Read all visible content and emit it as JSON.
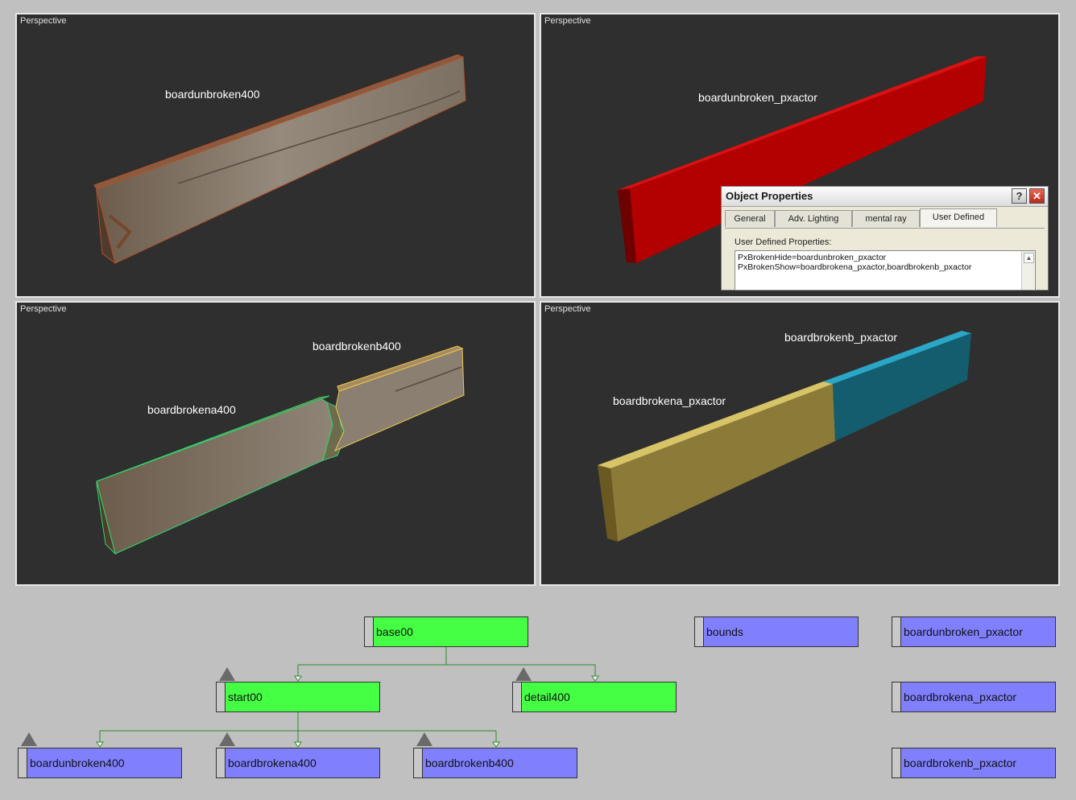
{
  "viewports": {
    "top_left": {
      "label": "Perspective",
      "objects": [
        "boardunbroken400"
      ]
    },
    "top_right": {
      "label": "Perspective",
      "objects": [
        "boardunbroken_pxactor"
      ]
    },
    "bottom_left": {
      "label": "Perspective",
      "objects": [
        "boardbrokenb400",
        "boardbrokena400"
      ]
    },
    "bottom_right": {
      "label": "Perspective",
      "objects": [
        "boardbrokenb_pxactor",
        "boardbrokena_pxactor"
      ]
    }
  },
  "dialog": {
    "title": "Object Properties",
    "help": "?",
    "close": "✕",
    "tabs": [
      "General",
      "Adv. Lighting",
      "mental ray",
      "User Defined"
    ],
    "active_tab": "User Defined",
    "field_label": "User Defined Properties:",
    "lines": [
      "PxBrokenHide=boardunbroken_pxactor",
      "PxBrokenShow=boardbrokena_pxactor,boardbrokenb_pxactor"
    ]
  },
  "graph": {
    "nodes": {
      "base00": "base00",
      "start00": "start00",
      "detail400": "detail400",
      "boardunbroken400": "boardunbroken400",
      "boardbrokena400": "boardbrokena400",
      "boardbrokenb400": "boardbrokenb400",
      "bounds": "bounds",
      "boardunbroken_pxactor": "boardunbroken_pxactor",
      "boardbrokena_pxactor": "boardbrokena_pxactor",
      "boardbrokenb_pxactor": "boardbrokenb_pxactor"
    }
  },
  "colors": {
    "viewport_bg": "#2f2f2f",
    "page_bg": "#c0c0c0",
    "node_green": "#44ff44",
    "node_blue": "#8080ff",
    "edge": "#2a8a2a",
    "wood": "#8a7d6c",
    "red_actor": "#c40000",
    "yellow_actor": "#8f7e3c",
    "cyan_actor": "#135d6e"
  }
}
